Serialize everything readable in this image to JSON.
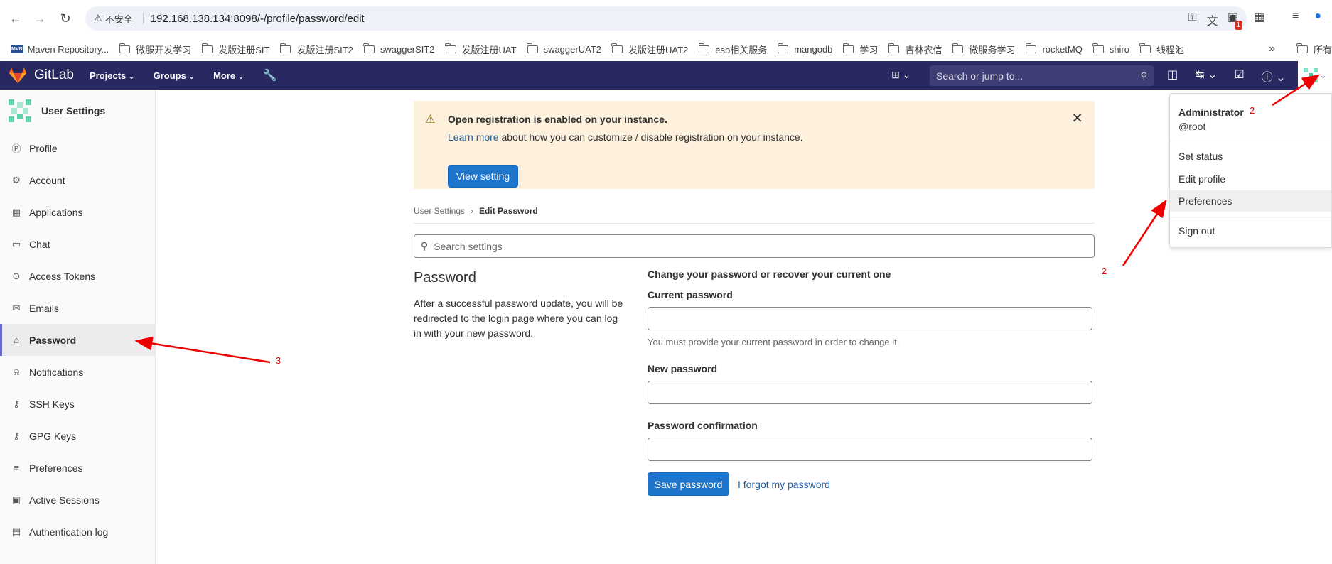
{
  "browser": {
    "security_label": "不安全",
    "url": "192.168.138.134:8098/-/profile/password/edit",
    "ext_badge": "1",
    "bookmarks": [
      {
        "label": "Maven Repository...",
        "type": "mvn"
      },
      {
        "label": "微服开发学习",
        "type": "folder"
      },
      {
        "label": "发版注册SIT",
        "type": "folder"
      },
      {
        "label": "发版注册SIT2",
        "type": "folder"
      },
      {
        "label": "swaggerSIT2",
        "type": "folder"
      },
      {
        "label": "发版注册UAT",
        "type": "folder"
      },
      {
        "label": "swaggerUAT2",
        "type": "folder"
      },
      {
        "label": "发版注册UAT2",
        "type": "folder"
      },
      {
        "label": "esb相关服务",
        "type": "folder"
      },
      {
        "label": "mangodb",
        "type": "folder"
      },
      {
        "label": "学习",
        "type": "folder"
      },
      {
        "label": "吉林农信",
        "type": "folder"
      },
      {
        "label": "微服务学习",
        "type": "folder"
      },
      {
        "label": "rocketMQ",
        "type": "folder"
      },
      {
        "label": "shiro",
        "type": "folder"
      },
      {
        "label": "线程池",
        "type": "folder"
      }
    ],
    "bookmarks_all": "所有"
  },
  "header": {
    "brand": "GitLab",
    "menu": [
      "Projects",
      "Groups",
      "More"
    ],
    "search_placeholder": "Search or jump to..."
  },
  "sidebar": {
    "title": "User Settings",
    "items": [
      {
        "label": "Profile",
        "icon": "profile-icon",
        "glyph": "Ⓟ"
      },
      {
        "label": "Account",
        "icon": "account-icon",
        "glyph": "⚙"
      },
      {
        "label": "Applications",
        "icon": "applications-icon",
        "glyph": "▦"
      },
      {
        "label": "Chat",
        "icon": "chat-icon",
        "glyph": "▭"
      },
      {
        "label": "Access Tokens",
        "icon": "token-icon",
        "glyph": "⊙"
      },
      {
        "label": "Emails",
        "icon": "mail-icon",
        "glyph": "✉"
      },
      {
        "label": "Password",
        "icon": "lock-icon",
        "glyph": "⌂",
        "active": true
      },
      {
        "label": "Notifications",
        "icon": "bell-icon",
        "glyph": "⍾"
      },
      {
        "label": "SSH Keys",
        "icon": "key-icon",
        "glyph": "⚷"
      },
      {
        "label": "GPG Keys",
        "icon": "key-icon",
        "glyph": "⚷"
      },
      {
        "label": "Preferences",
        "icon": "preferences-icon",
        "glyph": "≡"
      },
      {
        "label": "Active Sessions",
        "icon": "monitor-icon",
        "glyph": "▣"
      },
      {
        "label": "Authentication log",
        "icon": "log-icon",
        "glyph": "▤"
      }
    ]
  },
  "alert": {
    "title": "Open registration is enabled on your instance.",
    "link": "Learn more",
    "body_rest": " about how you can customize / disable registration on your instance.",
    "button": "View setting"
  },
  "breadcrumb": {
    "parent": "User Settings",
    "current": "Edit Password"
  },
  "search_settings_placeholder": "Search settings",
  "password_section": {
    "title": "Password",
    "description": "After a successful password update, you will be redirected to the login page where you can log in with your new password."
  },
  "form": {
    "lead": "Change your password or recover your current one",
    "current_label": "Current password",
    "current_help": "You must provide your current password in order to change it.",
    "new_label": "New password",
    "confirm_label": "Password confirmation",
    "save_button": "Save password",
    "forgot_link": "I forgot my password"
  },
  "dropdown": {
    "name": "Administrator",
    "username": "@root",
    "items": [
      "Set status",
      "Edit profile",
      "Preferences",
      "Sign out"
    ]
  },
  "annotations": {
    "a1": "2",
    "a2": "2",
    "a3": "3"
  },
  "colors": {
    "header_bg": "#292961",
    "accent": "#1f75cb",
    "alert_bg": "#fdf1dd",
    "annotation": "#ee0000"
  }
}
